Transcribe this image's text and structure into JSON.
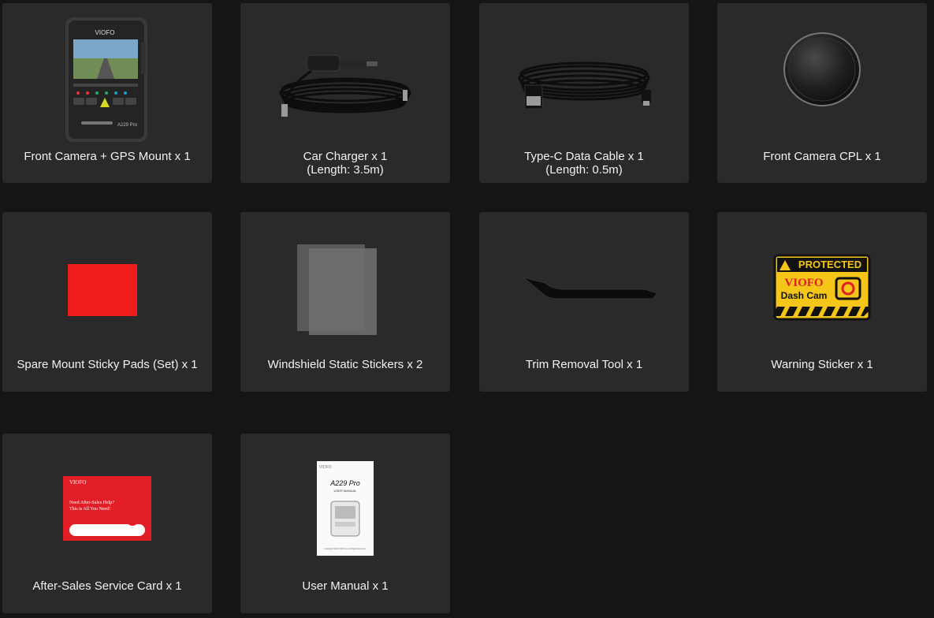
{
  "items": [
    {
      "label": "Front Camera + GPS Mount x 1",
      "sublabel": "",
      "icon": "dash-camera-icon"
    },
    {
      "label": "Car Charger x 1",
      "sublabel": "(Length: 3.5m)",
      "icon": "car-charger-icon"
    },
    {
      "label": "Type-C Data Cable x 1",
      "sublabel": "(Length: 0.5m)",
      "icon": "usb-cable-icon"
    },
    {
      "label": "Front Camera CPL x 1",
      "sublabel": "",
      "icon": "cpl-filter-icon"
    },
    {
      "label": "Spare Mount Sticky Pads (Set) x 1",
      "sublabel": "",
      "icon": "sticky-pad-icon"
    },
    {
      "label": "Windshield Static Stickers x 2",
      "sublabel": "",
      "icon": "static-sticker-icon"
    },
    {
      "label": "Trim Removal Tool x 1",
      "sublabel": "",
      "icon": "trim-tool-icon"
    },
    {
      "label": "Warning Sticker x 1",
      "sublabel": "",
      "icon": "warning-sticker-icon"
    },
    {
      "label": "After-Sales Service Card x 1",
      "sublabel": "",
      "icon": "service-card-icon"
    },
    {
      "label": "User Manual x 1",
      "sublabel": "",
      "icon": "user-manual-icon"
    }
  ],
  "images": {
    "camera_brand": "VIOFO",
    "camera_model": "A229 Pro",
    "sticker_top": "PROTECTED",
    "sticker_brand": "VIOFO",
    "sticker_sub": "Dash Cam",
    "card_brand": "VIOFO",
    "card_text_1": "Need After-Sales Help?",
    "card_text_2": "This is All You Need!",
    "manual_brand": "VIOFO",
    "manual_model": "A229 Pro",
    "manual_subtitle": "USER MANUAL",
    "manual_footer": "Copyright ©2023 VIOFO Ltd. All Rights Reserved."
  },
  "colors": {
    "page_background": "#151515",
    "card_background": "#2a2a2a",
    "text": "#f2f2f2",
    "sticky_pad": "#ef1c1c",
    "warning_yellow": "#f5c518",
    "service_card_red": "#e11d25"
  }
}
